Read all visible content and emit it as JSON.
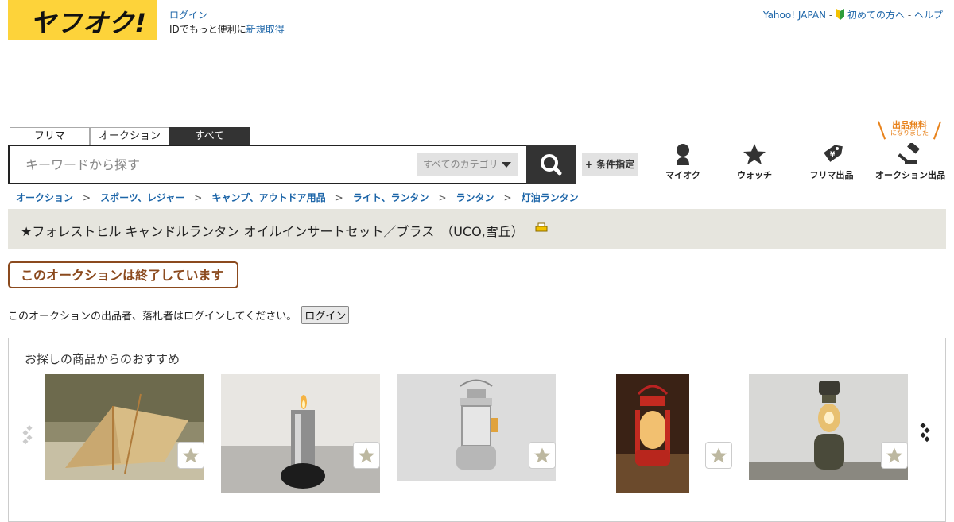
{
  "header": {
    "logo_text": "ヤフオク!",
    "login_link": "ログイン",
    "login_sub_prefix": "IDでもっと便利に",
    "register_link": "新規取得",
    "yahoo_japan": "Yahoo! JAPAN",
    "sep": " - ",
    "beginners": "初めての方へ",
    "help": "ヘルプ",
    "brand_color": "#fdd33a"
  },
  "tabs": {
    "flea": "フリマ",
    "auction": "オークション",
    "all": "すべて",
    "active": "all"
  },
  "search": {
    "placeholder": "キーワードから探す",
    "category": "すべてのカテゴリ",
    "condition_button": "+ 条件指定"
  },
  "nav": {
    "myauc": "マイオク",
    "watch": "ウォッチ",
    "flea_sell": "フリマ出品",
    "auction_sell": "オークション出品",
    "free_badge": "出品無料",
    "free_badge_sub": "になりました"
  },
  "breadcrumb": [
    "オークション",
    "スポーツ、レジャー",
    "キャンプ、アウトドア用品",
    "ライト、ランタン",
    "ランタン",
    "灯油ランタン"
  ],
  "breadcrumb_sep": ">",
  "item": {
    "title": "★フォレストヒル キャンドルランタン オイルインサートセット／ブラス　（UCO,雪丘）",
    "ended": "このオークションは終了しています",
    "login_notice": "このオークションの出品者、落札者はログインしてください。",
    "login_button": "ログイン"
  },
  "recommend": {
    "title": "お探しの商品からのおすすめ",
    "items": [
      {
        "name": "tent"
      },
      {
        "name": "oil-lamp"
      },
      {
        "name": "silver-lantern"
      },
      {
        "name": "red-lantern"
      },
      {
        "name": "vintage-lantern"
      }
    ]
  }
}
